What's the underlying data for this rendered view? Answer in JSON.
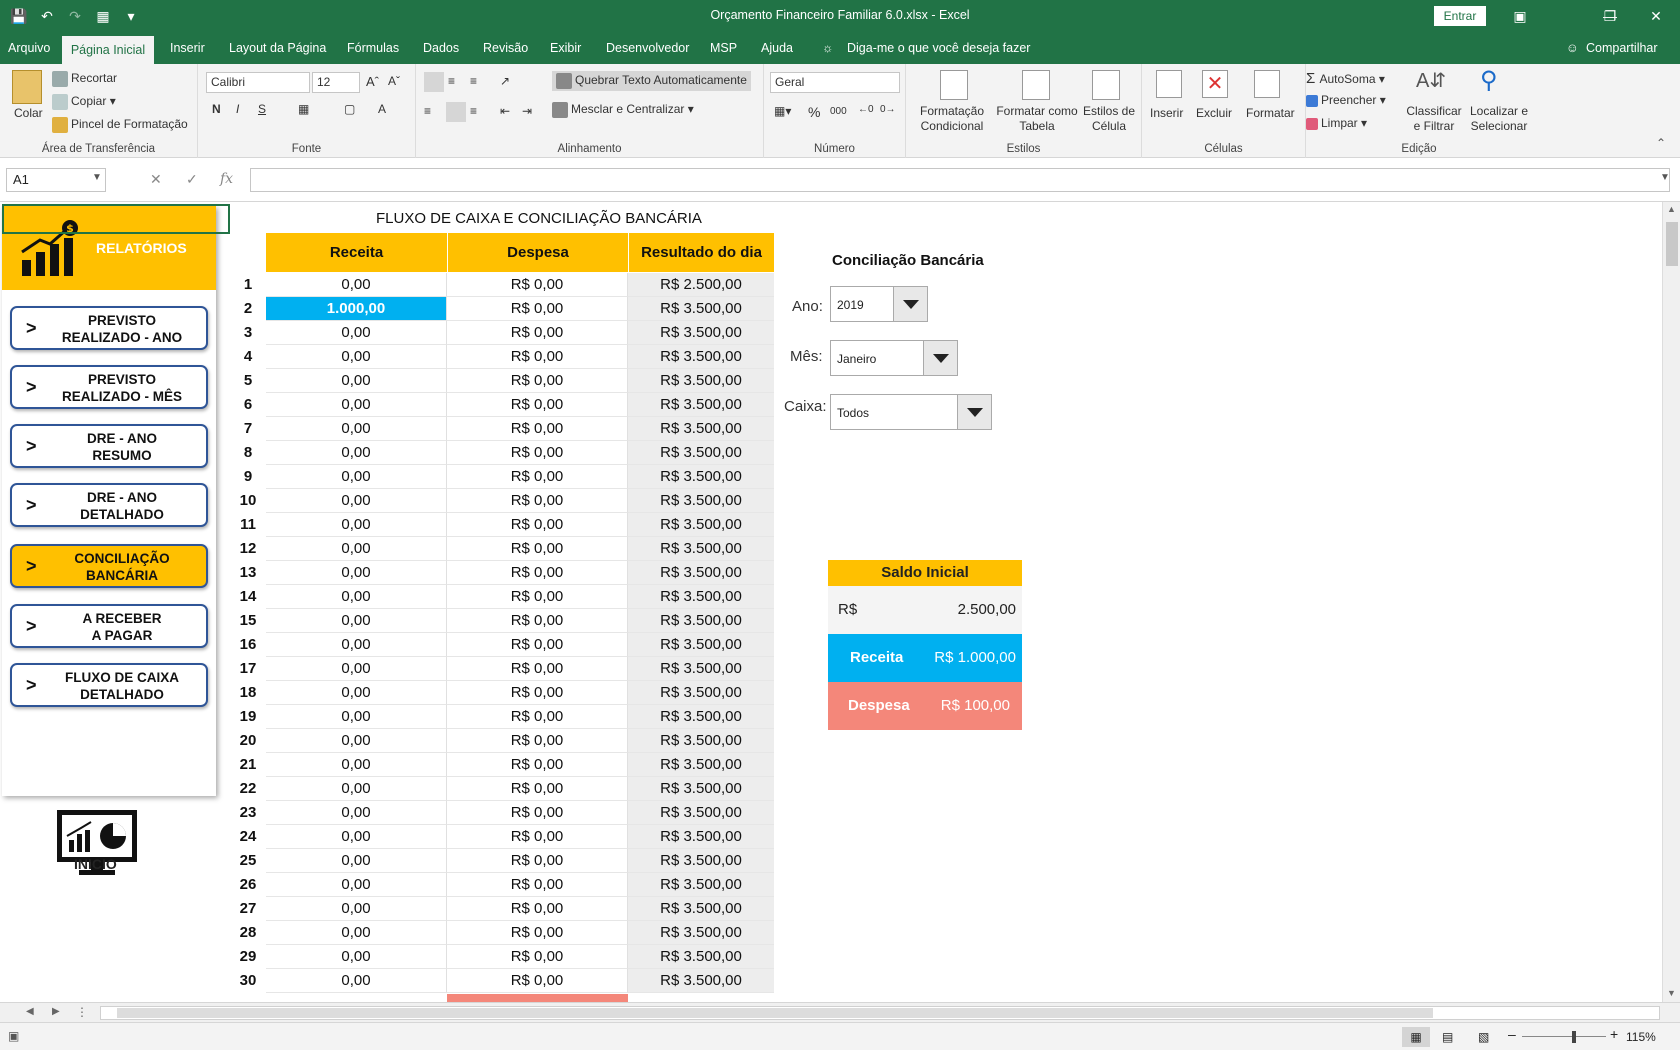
{
  "window": {
    "title": "Orçamento Financeiro Familiar 6.0.xlsx  -  Excel",
    "signin": "Entrar"
  },
  "menu": [
    "Arquivo",
    "Página Inicial",
    "Inserir",
    "Layout da Página",
    "Fórmulas",
    "Dados",
    "Revisão",
    "Exibir",
    "Desenvolvedor",
    "MSP",
    "Ajuda"
  ],
  "tellme": "Diga-me o que você deseja fazer",
  "share": "Compartilhar",
  "ribbon": {
    "clipboard": {
      "paste": "Colar",
      "cut": "Recortar",
      "copy": "Copiar",
      "painter": "Pincel de Formatação",
      "label": "Área de Transferência"
    },
    "font": {
      "name": "Calibri",
      "size": "12",
      "label": "Fonte",
      "bold": "N",
      "italic": "I",
      "underline": "S"
    },
    "alignment": {
      "wrap": "Quebrar Texto Automaticamente",
      "merge": "Mesclar e Centralizar",
      "label": "Alinhamento"
    },
    "number": {
      "format": "Geral",
      "percent": "%",
      "thousands": "000",
      "label": "Número"
    },
    "styles": {
      "cond": "Formatação Condicional",
      "table": "Formatar como Tabela",
      "cell": "Estilos de Célula",
      "label": "Estilos"
    },
    "cells": {
      "insert": "Inserir",
      "delete": "Excluir",
      "format": "Formatar",
      "label": "Células"
    },
    "editing": {
      "autosum": "AutoSoma",
      "fill": "Preencher",
      "clear": "Limpar",
      "sort": "Classificar e Filtrar",
      "find": "Localizar e Selecionar",
      "label": "Edição"
    }
  },
  "namebox": "A1",
  "fx": "fx",
  "nav": {
    "title": "RELATÓRIOS",
    "buttons": [
      {
        "l1": "PREVISTO",
        "l2": "REALIZADO - ANO"
      },
      {
        "l1": "PREVISTO",
        "l2": "REALIZADO - MÊS"
      },
      {
        "l1": "DRE - ANO",
        "l2": "RESUMO"
      },
      {
        "l1": "DRE - ANO",
        "l2": "DETALHADO"
      },
      {
        "l1": "CONCILIAÇÃO",
        "l2": "BANCÁRIA"
      },
      {
        "l1": "A RECEBER",
        "l2": "A PAGAR"
      },
      {
        "l1": "FLUXO DE CAIXA",
        "l2": "DETALHADO"
      }
    ],
    "chev": ">",
    "inicio": "INICIO"
  },
  "sheet": {
    "title": "FLUXO DE CAIXA E CONCILIAÇÃO BANCÁRIA",
    "headers": [
      "Receita",
      "Despesa",
      "Resultado do dia"
    ],
    "rows": [
      [
        "1",
        "0,00",
        "R$ 0,00",
        "R$ 2.500,00"
      ],
      [
        "2",
        "1.000,00",
        "R$ 0,00",
        "R$ 3.500,00"
      ],
      [
        "3",
        "0,00",
        "R$ 0,00",
        "R$ 3.500,00"
      ],
      [
        "4",
        "0,00",
        "R$ 0,00",
        "R$ 3.500,00"
      ],
      [
        "5",
        "0,00",
        "R$ 0,00",
        "R$ 3.500,00"
      ],
      [
        "6",
        "0,00",
        "R$ 0,00",
        "R$ 3.500,00"
      ],
      [
        "7",
        "0,00",
        "R$ 0,00",
        "R$ 3.500,00"
      ],
      [
        "8",
        "0,00",
        "R$ 0,00",
        "R$ 3.500,00"
      ],
      [
        "9",
        "0,00",
        "R$ 0,00",
        "R$ 3.500,00"
      ],
      [
        "10",
        "0,00",
        "R$ 0,00",
        "R$ 3.500,00"
      ],
      [
        "11",
        "0,00",
        "R$ 0,00",
        "R$ 3.500,00"
      ],
      [
        "12",
        "0,00",
        "R$ 0,00",
        "R$ 3.500,00"
      ],
      [
        "13",
        "0,00",
        "R$ 0,00",
        "R$ 3.500,00"
      ],
      [
        "14",
        "0,00",
        "R$ 0,00",
        "R$ 3.500,00"
      ],
      [
        "15",
        "0,00",
        "R$ 0,00",
        "R$ 3.500,00"
      ],
      [
        "16",
        "0,00",
        "R$ 0,00",
        "R$ 3.500,00"
      ],
      [
        "17",
        "0,00",
        "R$ 0,00",
        "R$ 3.500,00"
      ],
      [
        "18",
        "0,00",
        "R$ 0,00",
        "R$ 3.500,00"
      ],
      [
        "19",
        "0,00",
        "R$ 0,00",
        "R$ 3.500,00"
      ],
      [
        "20",
        "0,00",
        "R$ 0,00",
        "R$ 3.500,00"
      ],
      [
        "21",
        "0,00",
        "R$ 0,00",
        "R$ 3.500,00"
      ],
      [
        "22",
        "0,00",
        "R$ 0,00",
        "R$ 3.500,00"
      ],
      [
        "23",
        "0,00",
        "R$ 0,00",
        "R$ 3.500,00"
      ],
      [
        "24",
        "0,00",
        "R$ 0,00",
        "R$ 3.500,00"
      ],
      [
        "25",
        "0,00",
        "R$ 0,00",
        "R$ 3.500,00"
      ],
      [
        "26",
        "0,00",
        "R$ 0,00",
        "R$ 3.500,00"
      ],
      [
        "27",
        "0,00",
        "R$ 0,00",
        "R$ 3.500,00"
      ],
      [
        "28",
        "0,00",
        "R$ 0,00",
        "R$ 3.500,00"
      ],
      [
        "29",
        "0,00",
        "R$ 0,00",
        "R$ 3.500,00"
      ],
      [
        "30",
        "0,00",
        "R$ 0,00",
        "R$ 3.500,00"
      ]
    ],
    "highlight_row": "2"
  },
  "conciliacao": {
    "title": "Conciliação Bancária",
    "ano_label": "Ano:",
    "ano": "2019",
    "mes_label": "Mês:",
    "mes": "Janeiro",
    "caixa_label": "Caixa:",
    "caixa": "Todos",
    "saldo_label": "Saldo Inicial",
    "saldo_cur": "R$",
    "saldo_val": "2.500,00",
    "receita_label": "Receita",
    "receita_val": "R$ 1.000,00",
    "despesa_label": "Despesa",
    "despesa_val": "R$ 100,00"
  },
  "status": {
    "zoom": "115%"
  },
  "colors": {
    "excel_green": "#217346",
    "accent": "#ffc000",
    "blue": "#00b0f0",
    "salmon": "#f4877a",
    "navy": "#2f5597"
  }
}
